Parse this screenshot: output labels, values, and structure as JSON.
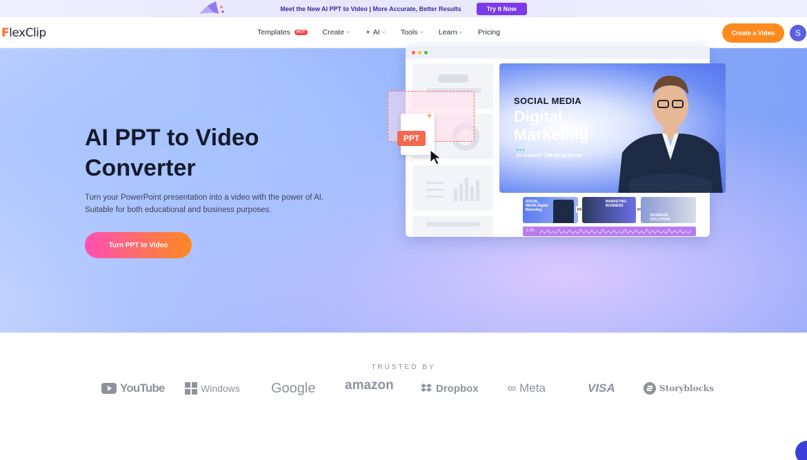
{
  "promo": {
    "text": "Meet the New AI PPT to Video | More Accurate, Better Results",
    "button": "Try It Now"
  },
  "nav": {
    "logo": "FlexClip",
    "items": [
      {
        "label": "Templates",
        "badge": "HOT"
      },
      {
        "label": "Create",
        "dropdown": true
      },
      {
        "label": "AI",
        "dropdown": true
      },
      {
        "label": "Tools",
        "dropdown": true
      },
      {
        "label": "Learn",
        "dropdown": true
      },
      {
        "label": "Pricing"
      }
    ],
    "cta": "Create a Video",
    "avatar_initial": "S"
  },
  "hero": {
    "title": "AI PPT to Video Converter",
    "subtitle": "Turn your PowerPoint presentation into a video with the power of AI. Suitable for both educational and business purposes.",
    "button": "Turn PPT to Video"
  },
  "illustration": {
    "ppt_tag": "PPT",
    "video": {
      "kicker": "SOCIAL MEDIA",
      "headline_line1": "Digital",
      "headline_line2": "Marketing",
      "date": "20 AUGUST  |  09:00-12:00 AM"
    },
    "thumbs": [
      {
        "text": "SOCIAL MEDIA Digital Marketing"
      },
      {
        "text": "MARKETING BUSINESS"
      },
      {
        "text": "BUSINESS SOLUTIONS"
      }
    ],
    "audio_time": "1:30"
  },
  "trusted": {
    "label": "TRUSTED BY",
    "brands": [
      "YouTube",
      "Windows",
      "Google",
      "amazon",
      "Dropbox",
      "Meta",
      "VISA",
      "Storyblocks"
    ]
  },
  "colors": {
    "accent_orange": "#ff8a1f",
    "promo_purple": "#7c3aed",
    "hero_gradient_start": "#ff4fb4"
  }
}
